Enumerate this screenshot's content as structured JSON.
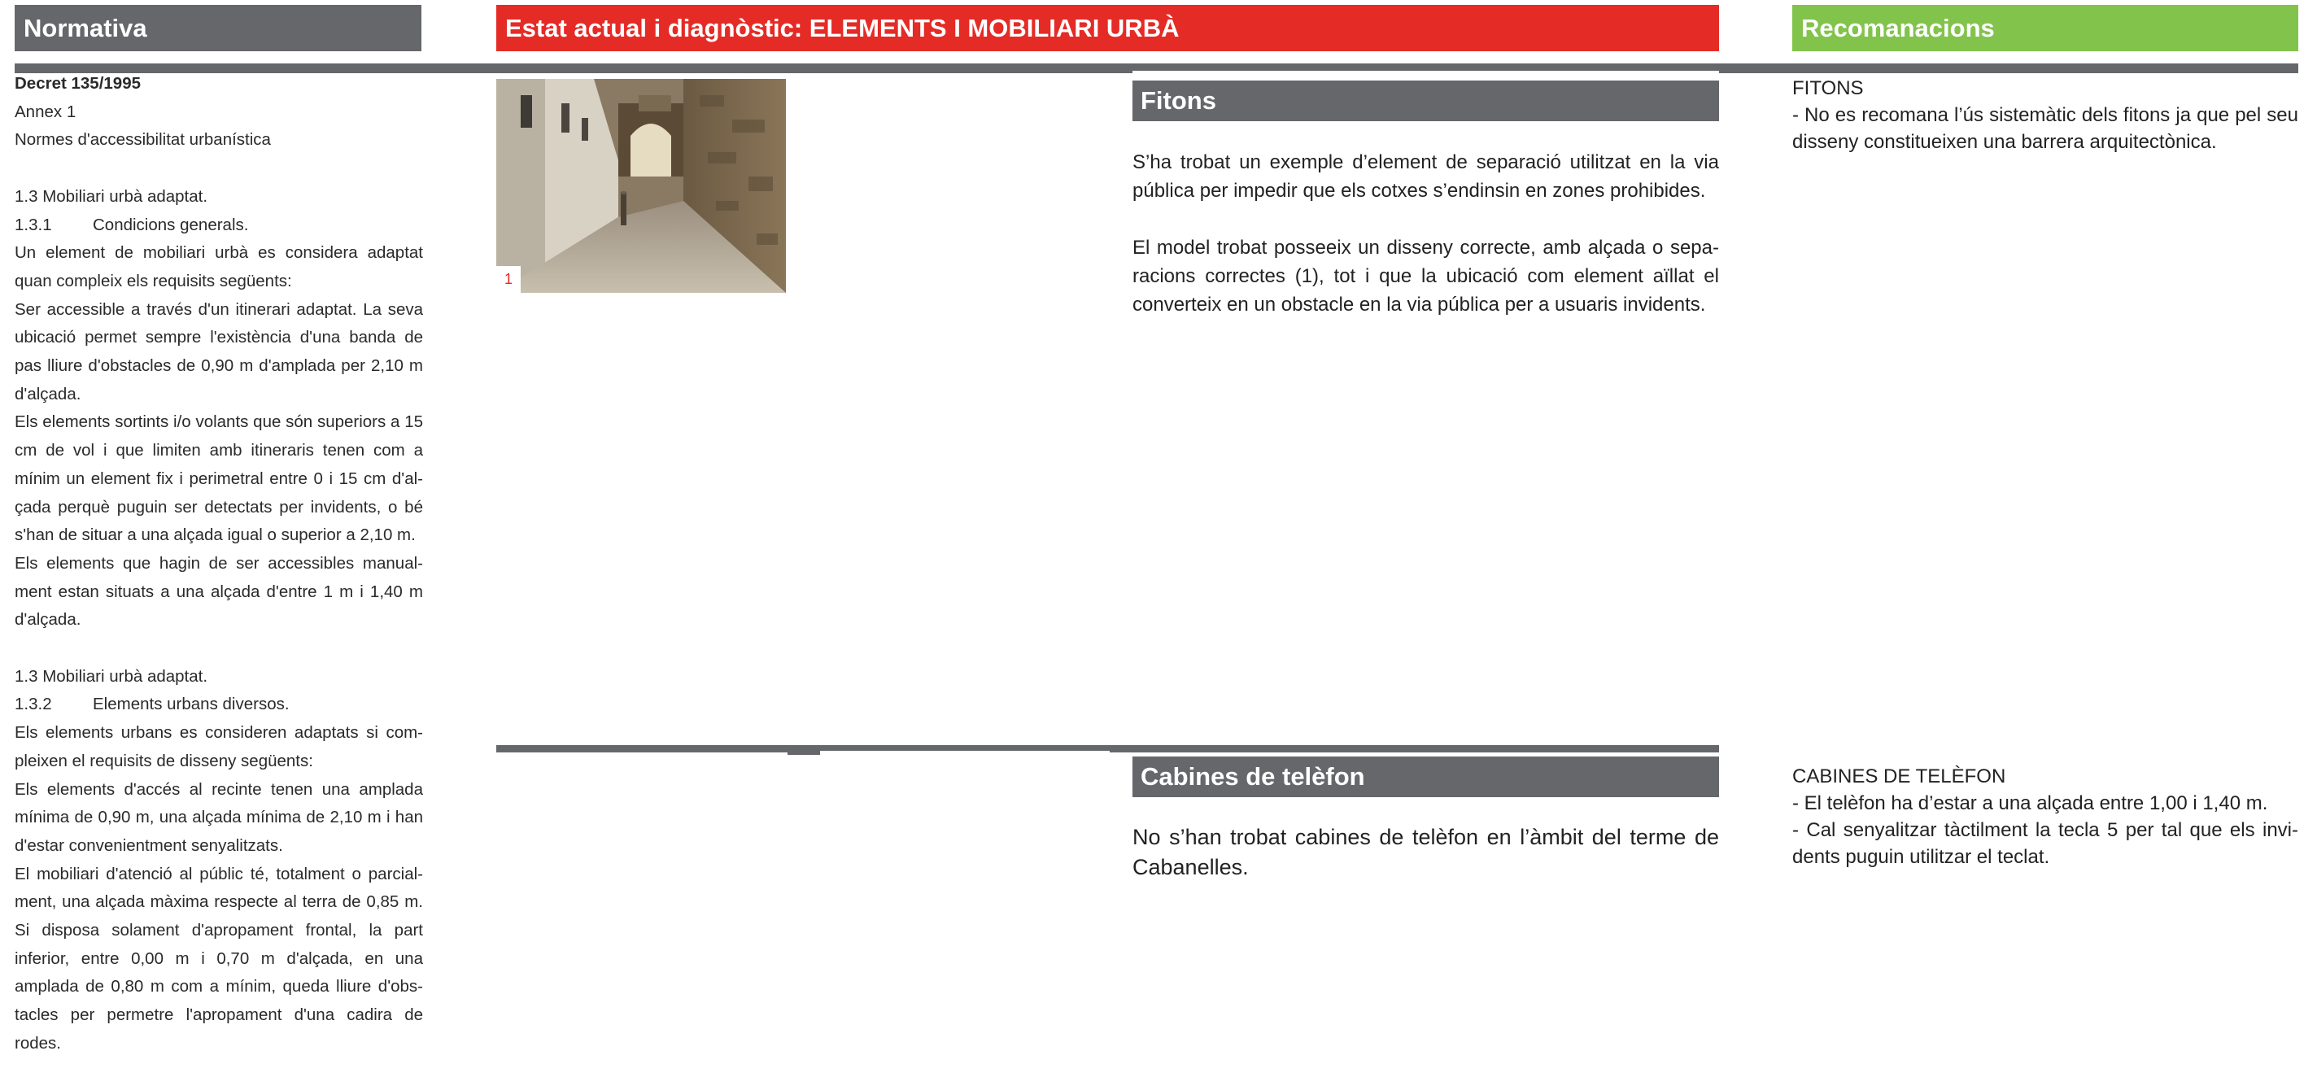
{
  "headers": {
    "normativa": "Normativa",
    "estat": "Estat actual i diagnòstic: ELEMENTS I MOBILIARI URBÀ",
    "recomanacions": "Recomanacions"
  },
  "colors": {
    "normativa_header": "#66676b",
    "estat_header": "#e42b26",
    "recomanacions_header": "#82c34c",
    "photo_label": "#e42b26"
  },
  "normativa": {
    "decret": "Decret 135/1995",
    "annex": "Annex 1",
    "normes": "Normes d'accessibilitat urbanística",
    "s1_title": "1.3 Mobiliari urbà adaptat.",
    "s1_sub_num": "1.3.1",
    "s1_sub_label": "Condicions generals.",
    "s1_p1": "Un element de mobiliari urbà es considera adaptat quan compleix els requisits següents:",
    "s1_p2": "Ser accessible a través d'un itinerari adaptat.  La seva ubicació permet sempre l'existència d'una banda de pas lliure d'obstacles de 0,90 m d'amplada per 2,10 m d'alçada.",
    "s1_p3": "Els elements sortints i/o volants que són superiors a 15 cm de vol i que limiten amb itineraris tenen com a mínim un element fix i perimetral entre 0 i 15 cm d'al­çada perquè puguin ser detectats per invidents, o bé s'han de situar a una alçada igual o superior a 2,10 m.",
    "s1_p4": "Els elements que hagin de ser accessibles manual­ment estan situats a una alçada d'entre 1 m i 1,40 m d'alçada.",
    "s2_title": "1.3 Mobiliari urbà adaptat.",
    "s2_sub_num": "1.3.2",
    "s2_sub_label": "Elements urbans diversos.",
    "s2_p1": "Els elements urbans es consideren adaptats si com­pleixen el requisits de disseny següents:",
    "s2_p2": "Els elements d'accés al recinte tenen una amplada mínima de 0,90 m, una alçada mínima de 2,10 m i han d'estar convenientment senyalitzats.",
    "s2_p3": "El mobiliari d'atenció al públic té, totalment o parcial­ment, una alçada màxima respecte al terra de 0,85 m.  Si disposa solament d'apropament frontal, la part inferior, entre 0,00 m i 0,70 m d'alçada, en una amplada de 0,80 m com a mínim, queda lliure d'obs­tacles per permetre l'apropament d'una cadira de rodes."
  },
  "photo": {
    "label": "1"
  },
  "fitons": {
    "title": "Fitons",
    "p1": "S’ha trobat un exemple d’element de separació utilitzat en la via pública per impedir que els cotxes s’endinsin en zones prohibides.",
    "p2": "El model trobat posseeix un disseny correcte, amb alçada o sepa­racions correctes (1), tot i que la ubicació com element aïllat el converteix en un obstacle en la via pública per a usuaris invidents."
  },
  "cabines": {
    "title": "Cabines de telèfon",
    "p1": "No s’han trobat cabines de telèfon en l’àmbit del terme de Cabanelles."
  },
  "recomanacions": {
    "fitons_title": "FITONS",
    "fitons_1": "- No es recomana l’ús sistemàtic dels fitons ja que pel seu disseny constitueixen una barrera arquitectònica.",
    "cabines_title": "CABINES DE TELÈFON",
    "cabines_1": "- El telèfon ha d’estar a una alçada entre 1,00 i 1,40 m.",
    "cabines_2": "- Cal senyalitzar tàctilment la tecla 5 per tal que els invi­dents puguin utilitzar el teclat."
  }
}
